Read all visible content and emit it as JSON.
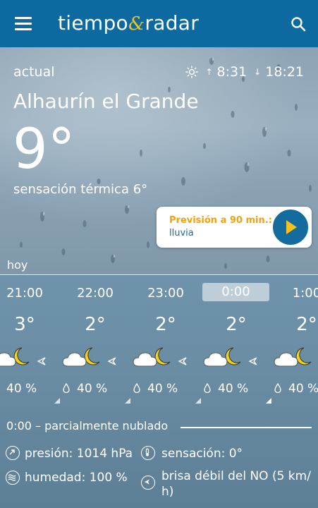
{
  "app": {
    "logo_part1": "tiempo",
    "logo_amp": "&",
    "logo_part2": "radar"
  },
  "current": {
    "label": "actual",
    "sunrise": "8:31",
    "sunset": "18:21",
    "city": "Alhaurín el Grande",
    "temperature": "9°",
    "feels_like": "sensación térmica 6°"
  },
  "forecast90": {
    "title": "Previsión a 90 min.:",
    "text": "lluvia"
  },
  "day_label": "hoy",
  "hours": [
    {
      "time": "21:00",
      "temp": "3°",
      "precip": "40 %",
      "selected": false
    },
    {
      "time": "22:00",
      "temp": "2°",
      "precip": "40 %",
      "selected": false
    },
    {
      "time": "23:00",
      "temp": "2°",
      "precip": "40 %",
      "selected": false
    },
    {
      "time": "0:00",
      "temp": "2°",
      "precip": "40 %",
      "selected": true
    },
    {
      "time": "1:00",
      "temp": "2°",
      "precip": "40 %",
      "selected": false
    }
  ],
  "selected_summary": "0:00 – parcialmente nublado",
  "details": {
    "pressure": "presión: 1014 hPa",
    "sensation": "sensación: 0°",
    "humidity": "humedad: 100 %",
    "wind_line1": "brisa débil del NO (5 km/",
    "wind_line2": "h)"
  },
  "colors": {
    "appbar": "#0c6aa0",
    "accent_yellow": "#f4c21c",
    "forecast_title": "#f1a20f",
    "play_button": "#146c9e"
  },
  "icons": [
    "menu-icon",
    "search-icon",
    "sun-icon",
    "play-icon",
    "partly-cloudy-night-icon",
    "wind-direction-icon",
    "rain-drop-icon",
    "pressure-icon",
    "thermometer-icon",
    "humidity-icon",
    "wind-icon"
  ]
}
